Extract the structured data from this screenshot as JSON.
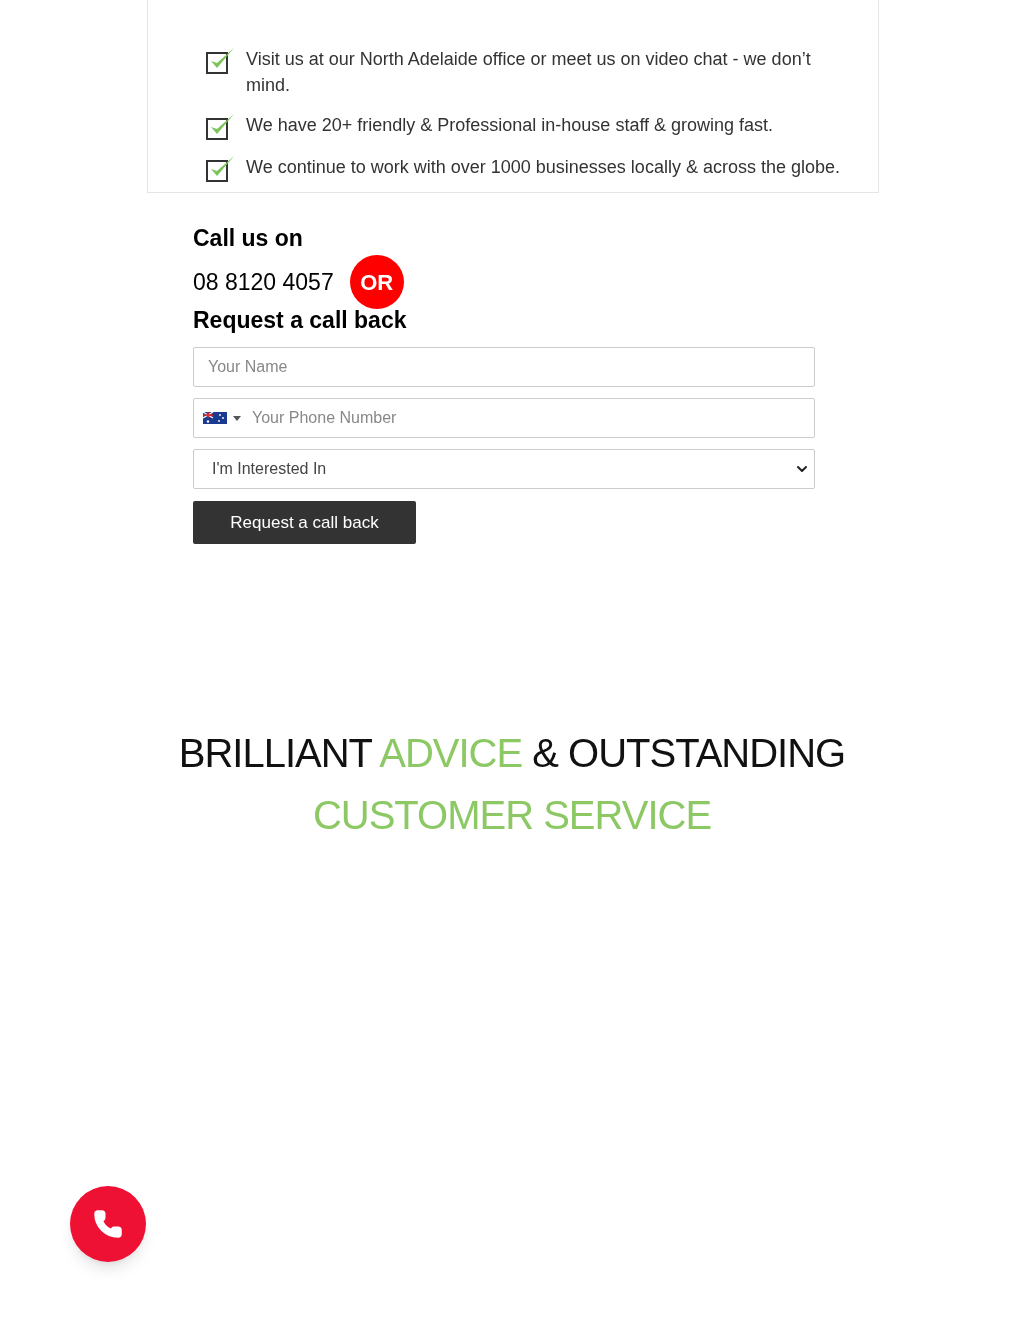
{
  "features": [
    {
      "text": "Visit us at our North Adelaide office or meet us on video chat - we don’t mind.",
      "checked": true
    },
    {
      "text": "We have 20+ friendly & Professional in-house staff & growing fast.",
      "checked": true
    },
    {
      "text": "We continue to work with over 1000 businesses locally & across the globe.",
      "checked": true
    }
  ],
  "call": {
    "heading": "Call us on",
    "phone": "08 8120 4057",
    "or_badge": "OR"
  },
  "form": {
    "heading": "Request a call back",
    "name_field": {
      "placeholder": "Your Name"
    },
    "phone_field": {
      "placeholder": "Your Phone Number"
    },
    "interest_select": {
      "value": "I'm Interested In"
    },
    "submit": "Request a call back"
  },
  "headline": {
    "lines": [
      [
        {
          "text": "BRILLIANT ",
          "accent": false
        },
        {
          "text": "ADVICE",
          "accent": true
        },
        {
          "text": " & OUTSTANDING",
          "accent": false
        }
      ],
      [
        {
          "text": "CUSTOMER SERVICE",
          "accent": true
        }
      ]
    ]
  }
}
